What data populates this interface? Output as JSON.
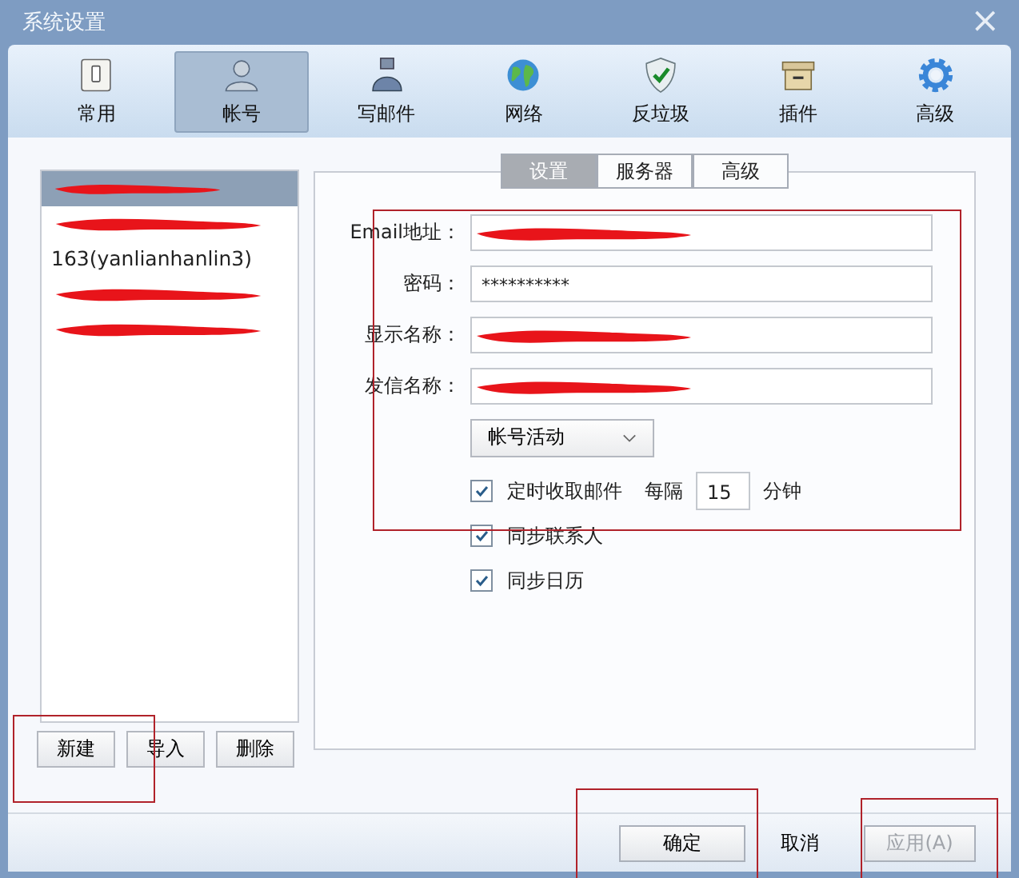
{
  "window": {
    "title": "系统设置",
    "close": "×"
  },
  "toolbar": [
    {
      "label": "常用",
      "selected": false
    },
    {
      "label": "帐号",
      "selected": true
    },
    {
      "label": "写邮件",
      "selected": false
    },
    {
      "label": "网络",
      "selected": false
    },
    {
      "label": "反垃圾",
      "selected": false
    },
    {
      "label": "插件",
      "selected": false
    },
    {
      "label": "高级",
      "selected": false
    }
  ],
  "accounts": [
    {
      "redacted": true,
      "selected": true
    },
    {
      "redacted": true,
      "selected": false
    },
    {
      "label": "163(yanlianhanlin3)",
      "selected": false
    },
    {
      "redacted": true,
      "selected": false
    },
    {
      "redacted": true,
      "selected": false
    }
  ],
  "account_buttons": [
    "新建",
    "导入",
    "删除"
  ],
  "subtabs": [
    {
      "label": "设置",
      "selected": true
    },
    {
      "label": "服务器",
      "selected": false
    },
    {
      "label": "高级",
      "selected": false
    }
  ],
  "form": [
    {
      "label": "Email地址：",
      "redacted": true
    },
    {
      "label": "密码：",
      "value": "**********"
    },
    {
      "label": "显示名称：",
      "redacted": true
    },
    {
      "label": "发信名称：",
      "redacted": true
    }
  ],
  "activity_select": "帐号活动",
  "options": [
    {
      "kind": "interval",
      "label": "定时收取邮件",
      "checked": true,
      "every": "每隔",
      "minutes": "15",
      "unit": "分钟"
    },
    {
      "kind": "plain",
      "label": "同步联系人",
      "checked": true
    },
    {
      "kind": "plain",
      "label": "同步日历",
      "checked": true
    }
  ],
  "footer_buttons": [
    {
      "label": "确定",
      "kind": "default",
      "disabled": false
    },
    {
      "label": "取消",
      "kind": "flat",
      "disabled": false
    },
    {
      "label": "应用(A)",
      "kind": "normal",
      "disabled": true
    }
  ],
  "annotations": [
    {
      "kind": "form"
    },
    {
      "kind": "new"
    },
    {
      "kind": "ok"
    },
    {
      "kind": "apply"
    }
  ]
}
